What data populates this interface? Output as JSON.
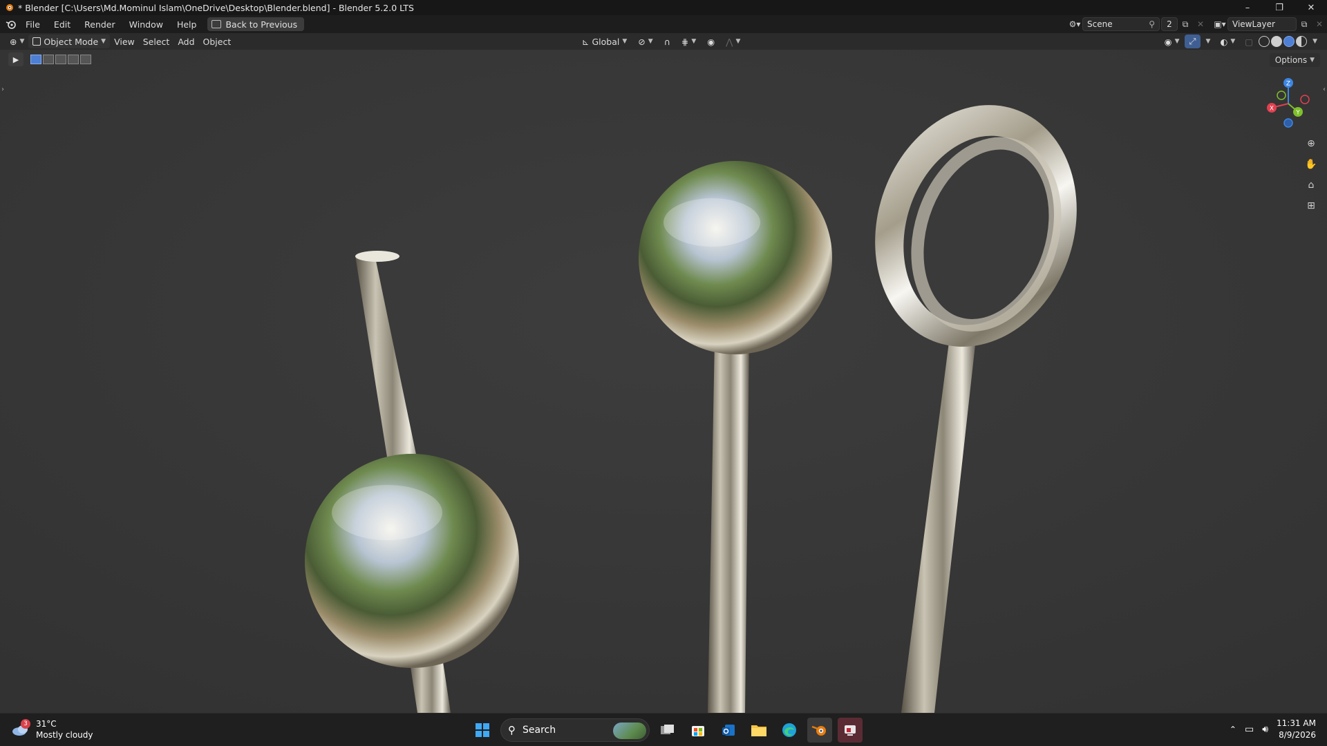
{
  "window": {
    "title": "* Blender [C:\\Users\\Md.Mominul Islam\\OneDrive\\Desktop\\Blender.blend] - Blender 5.2.0 LTS",
    "controls": {
      "minimize": "–",
      "maximize": "❐",
      "close": "✕"
    }
  },
  "menu": {
    "items": [
      "File",
      "Edit",
      "Render",
      "Window",
      "Help"
    ],
    "back_label": "Back to Previous"
  },
  "scene": {
    "name": "Scene",
    "count": "2",
    "view_layer": "ViewLayer"
  },
  "viewport_header": {
    "mode": "Object Mode",
    "menus": [
      "View",
      "Select",
      "Add",
      "Object"
    ],
    "orientation": "Global",
    "options_label": "Options"
  },
  "gizmo": {
    "x": "X",
    "y": "Y",
    "z": "Z"
  },
  "colors": {
    "axis_x": "#e2404f",
    "axis_y": "#7fbf2a",
    "axis_z": "#3c86e4",
    "accent": "#4d7fd6",
    "viewport_bg": "#393939"
  },
  "taskbar": {
    "weather_badge": "3",
    "temperature": "31°C",
    "condition": "Mostly cloudy",
    "search_label": "Search",
    "time": "11:31 AM",
    "date": "8/9/2026"
  }
}
